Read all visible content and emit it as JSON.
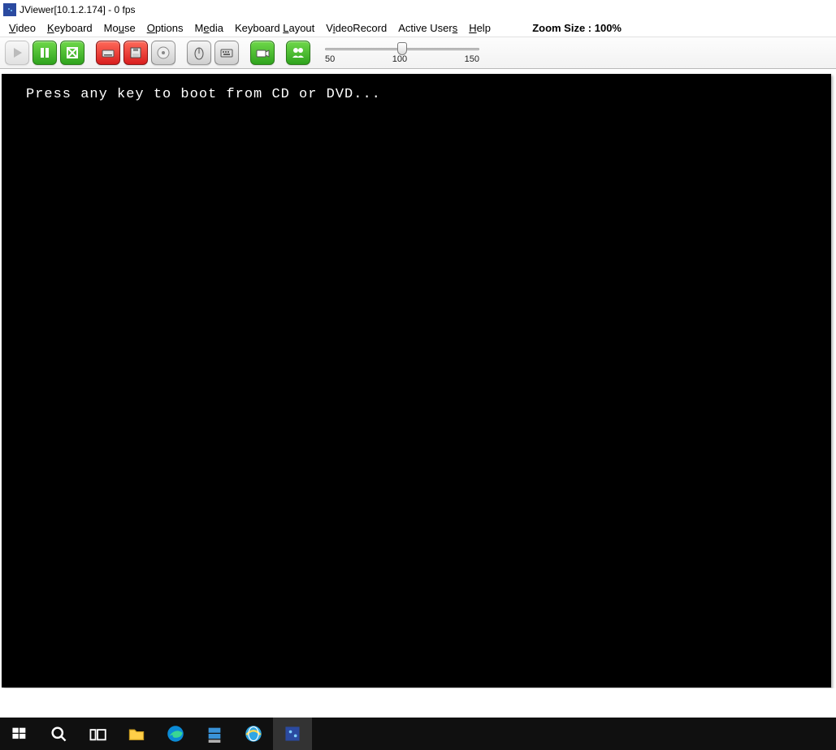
{
  "titlebar": {
    "title": "JViewer[10.1.2.174] - 0 fps"
  },
  "menubar": {
    "items": [
      {
        "pre": "",
        "u": "V",
        "post": "ideo"
      },
      {
        "pre": "",
        "u": "K",
        "post": "eyboard"
      },
      {
        "pre": "Mo",
        "u": "u",
        "post": "se"
      },
      {
        "pre": "",
        "u": "O",
        "post": "ptions"
      },
      {
        "pre": "M",
        "u": "e",
        "post": "dia"
      },
      {
        "pre": "Keyboard ",
        "u": "L",
        "post": "ayout"
      },
      {
        "pre": "V",
        "u": "i",
        "post": "deoRecord"
      },
      {
        "pre": "Active User",
        "u": "s",
        "post": ""
      },
      {
        "pre": "",
        "u": "H",
        "post": "elp"
      }
    ],
    "zoom_label": "Zoom Size : 100%"
  },
  "toolbar": {
    "buttons": [
      {
        "name": "play-button",
        "icon": "play",
        "style": "gray",
        "disabled": true
      },
      {
        "name": "pause-button",
        "icon": "pause",
        "style": "green",
        "disabled": false
      },
      {
        "name": "fullscreen-button",
        "icon": "fullscreen",
        "style": "green",
        "disabled": false
      },
      {
        "sep": true
      },
      {
        "name": "cdrom-button",
        "icon": "drive",
        "style": "red",
        "disabled": false
      },
      {
        "name": "floppy-button",
        "icon": "floppy",
        "style": "red",
        "disabled": false
      },
      {
        "name": "disc-button",
        "icon": "disc",
        "style": "gray",
        "disabled": false
      },
      {
        "sep": true
      },
      {
        "name": "mouse-button",
        "icon": "mouse",
        "style": "gray",
        "disabled": false
      },
      {
        "name": "keyboard-button",
        "icon": "keyboard",
        "style": "gray",
        "disabled": false
      },
      {
        "sep": true
      },
      {
        "name": "record-button",
        "icon": "camera",
        "style": "green",
        "disabled": false
      },
      {
        "sep": true
      },
      {
        "name": "users-button",
        "icon": "users",
        "style": "green",
        "disabled": false
      }
    ],
    "slider": {
      "min": "50",
      "mid": "100",
      "max": "150",
      "value": 100
    }
  },
  "console": {
    "text": "Press any key to boot from CD or DVD..."
  },
  "taskbar": {
    "items": [
      {
        "name": "start-button",
        "icon": "windows"
      },
      {
        "name": "search-button",
        "icon": "search"
      },
      {
        "name": "task-view-button",
        "icon": "taskview"
      },
      {
        "name": "file-explorer-app",
        "icon": "folder"
      },
      {
        "name": "edge-app",
        "icon": "edge"
      },
      {
        "name": "server-manager-app",
        "icon": "server"
      },
      {
        "name": "ie-app",
        "icon": "ie"
      },
      {
        "name": "jviewer-app",
        "icon": "jviewer",
        "active": true
      }
    ]
  }
}
